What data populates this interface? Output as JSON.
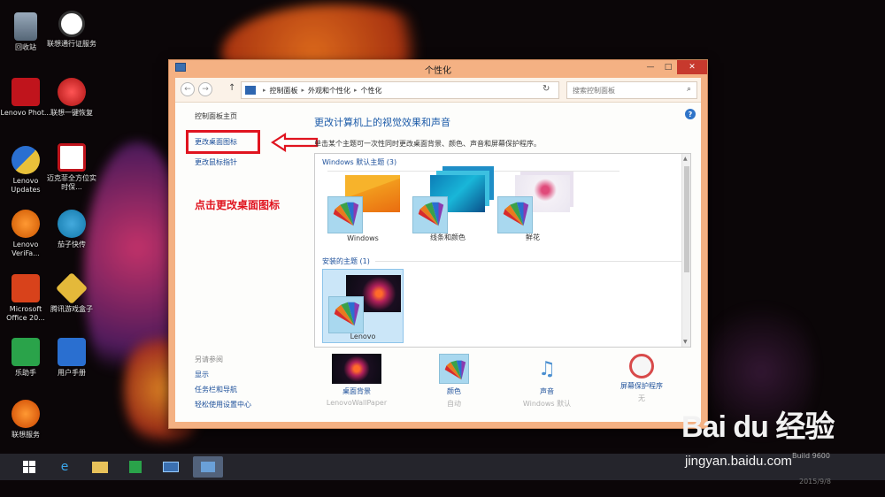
{
  "window": {
    "title": "个性化",
    "controls": {
      "minimize": "—",
      "maximize": "□",
      "close": "✕"
    }
  },
  "addressbar": {
    "back": "←",
    "forward": "→",
    "up": "↑",
    "breadcrumb": [
      "控制面板",
      "外观和个性化",
      "个性化"
    ],
    "search_placeholder": "搜索控制面板"
  },
  "left_pane": {
    "home": "控制面板主页",
    "change_desktop_icons": "更改桌面图标",
    "change_mouse_pointer": "更改鼠标指针",
    "annotation": "点击更改桌面图标",
    "see_also_title": "另请参阅",
    "see_also": [
      "显示",
      "任务栏和导航",
      "轻松使用设置中心"
    ]
  },
  "content": {
    "heading": "更改计算机上的视觉效果和声音",
    "subtext": "单击某个主题可一次性同时更改桌面背景、颜色、声音和屏幕保护程序。",
    "help": "?",
    "groups": [
      {
        "title": "Windows 默认主题 (3)",
        "themes": [
          "Windows",
          "线条和颜色",
          "鲜花"
        ]
      },
      {
        "title": "安装的主题 (1)",
        "themes": [
          "Lenovo"
        ]
      }
    ]
  },
  "bottom_bar": [
    {
      "label": "桌面背景",
      "sub": "LenovoWallPaper",
      "icon": "wallpaper-icon"
    },
    {
      "label": "颜色",
      "sub": "自动",
      "icon": "color-icon"
    },
    {
      "label": "声音",
      "sub": "Windows 默认",
      "icon": "sound-icon"
    },
    {
      "label": "屏幕保护程序",
      "sub": "无",
      "icon": "screensaver-icon"
    }
  ],
  "desktop_icons": [
    {
      "label": "回收站"
    },
    {
      "label": "联想通行证服务"
    },
    {
      "label": "Lenovo Phot..."
    },
    {
      "label": "联想一键恢复"
    },
    {
      "label": "Lenovo Updates"
    },
    {
      "label": "迈克菲全方位实时保..."
    },
    {
      "label": "Lenovo VeriFa..."
    },
    {
      "label": "茄子快传"
    },
    {
      "label": "Microsoft Office 20..."
    },
    {
      "label": "腾讯游戏盒子"
    },
    {
      "label": "乐助手"
    },
    {
      "label": "用户手册"
    },
    {
      "label": "联想服务"
    }
  ],
  "watermark": {
    "logo": "Bai du 经验",
    "url": "jingyan.baidu.com",
    "build": "Build 9600",
    "date": "2015/9/8"
  },
  "colors": {
    "window_frame": "#f4b183",
    "close_button": "#c7392d",
    "link": "#1c4f9a",
    "heading": "#1b5aa8",
    "annotation": "#e0141f",
    "selected_theme": "#cbe6f8"
  }
}
